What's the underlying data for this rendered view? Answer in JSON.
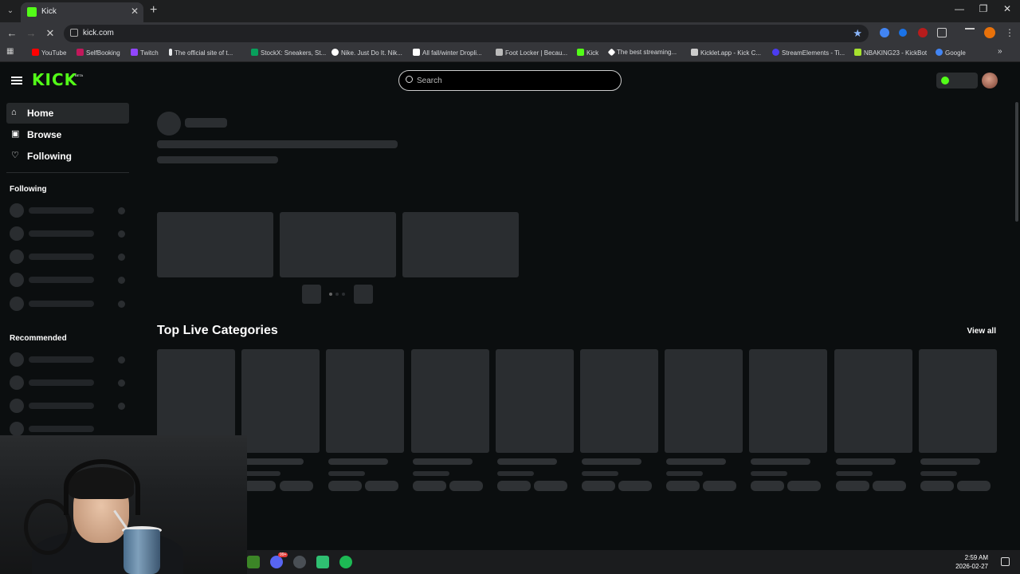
{
  "browser": {
    "tab": {
      "title": "Kick"
    },
    "url": "kick.com",
    "bookmarks": [
      {
        "label": "YouTube",
        "color": "#ff0000"
      },
      {
        "label": "SelfBooking",
        "color": "#c2185b"
      },
      {
        "label": "Twitch",
        "color": "#9146ff"
      },
      {
        "label": "The official site of t...",
        "color": "#e8eaed"
      },
      {
        "label": "StockX: Sneakers, St...",
        "color": "#08a05c"
      },
      {
        "label": "Nike. Just Do It. Nik...",
        "color": "#ffffff"
      },
      {
        "label": "All fall/winter Dropli...",
        "color": "#ffffff"
      },
      {
        "label": "Foot Locker | Becau...",
        "color": "#bbbbbb"
      },
      {
        "label": "Kick",
        "color": "#53fc18"
      },
      {
        "label": "The best streaming...",
        "color": "#ffffff"
      },
      {
        "label": "Kicklet.app - Kick C...",
        "color": "#cccccc"
      },
      {
        "label": "StreamElements - Ti...",
        "color": "#4b3cf0"
      },
      {
        "label": "NBAKING23 - KickBot",
        "color": "#a6e22e"
      },
      {
        "label": "Google",
        "color": "#4285f4"
      }
    ]
  },
  "kick": {
    "logo": "KICK",
    "logo_badge": "BETA",
    "search": {
      "placeholder": "Search"
    },
    "sidebar": {
      "nav": [
        {
          "label": "Home",
          "icon": "home-icon"
        },
        {
          "label": "Browse",
          "icon": "browse-icon"
        },
        {
          "label": "Following",
          "icon": "heart-icon"
        }
      ],
      "following_title": "Following",
      "recommended_title": "Recommended"
    },
    "categories": {
      "title": "Top Live Categories",
      "view_all": "View all"
    }
  },
  "taskbar": {
    "time": "2:59 AM",
    "date": "2026-02-27",
    "discord_badge": "99+",
    "apps": [
      {
        "name": "minecraft",
        "color": "#3c8527"
      },
      {
        "name": "discord",
        "color": "#5865f2"
      },
      {
        "name": "4k",
        "color": "#4a4f55"
      },
      {
        "name": "app-green",
        "color": "#2fbf71"
      },
      {
        "name": "spotify",
        "color": "#1db954"
      }
    ]
  },
  "colors": {
    "accent": "#53fc18",
    "bg": "#0b0e0f",
    "skeleton": "#2a2d30"
  }
}
